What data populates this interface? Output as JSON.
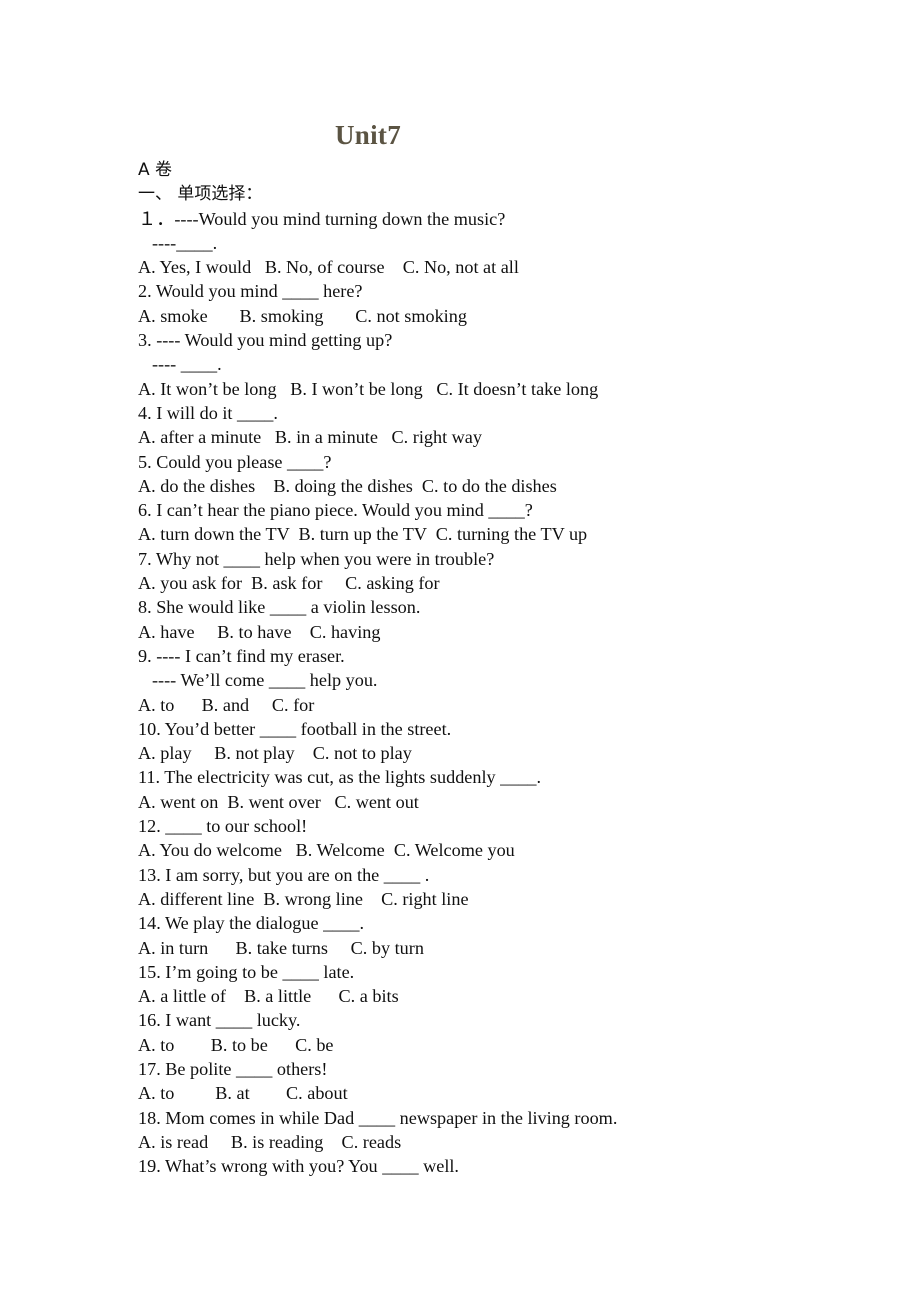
{
  "document": {
    "title": "Unit7",
    "title_color": "#5b5443",
    "background_color": "#ffffff",
    "text_color": "#101010",
    "paper_section": "A 卷",
    "section_heading": "一、 单项选择：",
    "lines": [
      {
        "id": "paper-section",
        "text": "A 卷",
        "script": "cjk",
        "indent": false
      },
      {
        "id": "section-heading",
        "text": "一、 单项选择：",
        "script": "cjk",
        "indent": false
      },
      {
        "id": "q1-stem",
        "text": "１．----Would you mind turning down the music?",
        "script": "latin",
        "indent": false
      },
      {
        "id": "q1-reply",
        "text": "----____.",
        "script": "latin",
        "indent": true
      },
      {
        "id": "q1-options",
        "text": "A. Yes, I would   B. No, of course    C. No, not at all",
        "script": "latin",
        "indent": false
      },
      {
        "id": "q2-stem",
        "text": "2. Would you mind ____ here?",
        "script": "latin",
        "indent": false
      },
      {
        "id": "q2-options",
        "text": "A. smoke       B. smoking       C. not smoking",
        "script": "latin",
        "indent": false
      },
      {
        "id": "q3-stem",
        "text": "3. ---- Would you mind getting up?",
        "script": "latin",
        "indent": false
      },
      {
        "id": "q3-reply",
        "text": "---- ____.",
        "script": "latin",
        "indent": true
      },
      {
        "id": "q3-options",
        "text": "A. It won’t be long   B. I won’t be long   C. It doesn’t take long",
        "script": "latin",
        "indent": false
      },
      {
        "id": "q4-stem",
        "text": "4. I will do it ____.",
        "script": "latin",
        "indent": false
      },
      {
        "id": "q4-options",
        "text": "A. after a minute   B. in a minute   C. right way",
        "script": "latin",
        "indent": false
      },
      {
        "id": "q5-stem",
        "text": "5. Could you please ____?",
        "script": "latin",
        "indent": false
      },
      {
        "id": "q5-options",
        "text": "A. do the dishes    B. doing the dishes  C. to do the dishes",
        "script": "latin",
        "indent": false
      },
      {
        "id": "q6-stem",
        "text": "6. I can’t hear the piano piece. Would you mind ____?",
        "script": "latin",
        "indent": false
      },
      {
        "id": "q6-options",
        "text": "A. turn down the TV  B. turn up the TV  C. turning the TV up",
        "script": "latin",
        "indent": false
      },
      {
        "id": "q7-stem",
        "text": "7. Why not ____ help when you were in trouble?",
        "script": "latin",
        "indent": false
      },
      {
        "id": "q7-options",
        "text": "A. you ask for  B. ask for     C. asking for",
        "script": "latin",
        "indent": false
      },
      {
        "id": "q8-stem",
        "text": "8. She would like ____ a violin lesson.",
        "script": "latin",
        "indent": false
      },
      {
        "id": "q8-options",
        "text": "A. have     B. to have    C. having",
        "script": "latin",
        "indent": false
      },
      {
        "id": "q9-stem",
        "text": "9. ---- I can’t find my eraser.",
        "script": "latin",
        "indent": false
      },
      {
        "id": "q9-reply",
        "text": "---- We’ll come ____ help you.",
        "script": "latin",
        "indent": true
      },
      {
        "id": "q9-options",
        "text": "A. to      B. and     C. for",
        "script": "latin",
        "indent": false
      },
      {
        "id": "q10-stem",
        "text": "10. You’d better ____ football in the street.",
        "script": "latin",
        "indent": false
      },
      {
        "id": "q10-options",
        "text": "A. play     B. not play    C. not to play",
        "script": "latin",
        "indent": false
      },
      {
        "id": "q11-stem",
        "text": "11. The electricity was cut, as the lights suddenly ____.",
        "script": "latin",
        "indent": false
      },
      {
        "id": "q11-options",
        "text": "A. went on  B. went over   C. went out",
        "script": "latin",
        "indent": false
      },
      {
        "id": "q12-stem",
        "text": "12. ____ to our school!",
        "script": "latin",
        "indent": false
      },
      {
        "id": "q12-options",
        "text": "A. You do welcome   B. Welcome  C. Welcome you",
        "script": "latin",
        "indent": false
      },
      {
        "id": "q13-stem",
        "text": "13. I am sorry, but you are on the ____ .",
        "script": "latin",
        "indent": false
      },
      {
        "id": "q13-options",
        "text": "A. different line  B. wrong line    C. right line",
        "script": "latin",
        "indent": false
      },
      {
        "id": "q14-stem",
        "text": "14. We play the dialogue ____.",
        "script": "latin",
        "indent": false
      },
      {
        "id": "q14-options",
        "text": "A. in turn      B. take turns     C. by turn",
        "script": "latin",
        "indent": false
      },
      {
        "id": "q15-stem",
        "text": "15. I’m going to be ____ late.",
        "script": "latin",
        "indent": false
      },
      {
        "id": "q15-options",
        "text": "A. a little of    B. a little      C. a bits",
        "script": "latin",
        "indent": false
      },
      {
        "id": "q16-stem",
        "text": "16. I want ____ lucky.",
        "script": "latin",
        "indent": false
      },
      {
        "id": "q16-options",
        "text": "A. to        B. to be      C. be",
        "script": "latin",
        "indent": false
      },
      {
        "id": "q17-stem",
        "text": "17. Be polite ____ others!",
        "script": "latin",
        "indent": false
      },
      {
        "id": "q17-options",
        "text": "A. to         B. at        C. about",
        "script": "latin",
        "indent": false
      },
      {
        "id": "q18-stem",
        "text": "18. Mom comes in while Dad ____ newspaper in the living room.",
        "script": "latin",
        "indent": false
      },
      {
        "id": "q18-options",
        "text": "A. is read     B. is reading    C. reads",
        "script": "latin",
        "indent": false
      },
      {
        "id": "q19-stem",
        "text": "19. What’s wrong with you? You ____ well.",
        "script": "latin",
        "indent": false
      }
    ]
  }
}
